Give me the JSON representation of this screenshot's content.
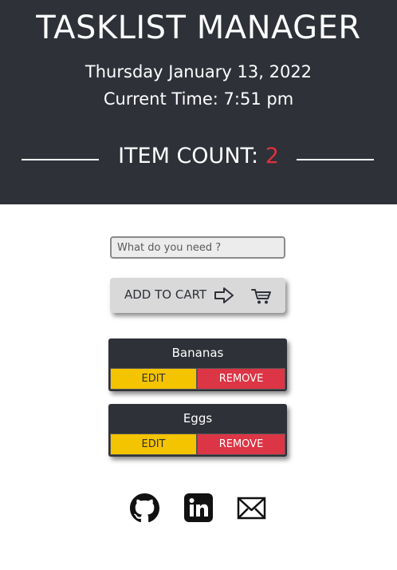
{
  "header": {
    "title": "TASKLIST MANAGER",
    "date": "Thursday January 13, 2022",
    "time": "Current Time: 7:51 pm",
    "item_count_label": "ITEM COUNT: ",
    "item_count": "2"
  },
  "form": {
    "input_placeholder": "What do you need ?",
    "input_value": "",
    "add_button_label": "ADD TO CART",
    "icons": [
      "arrow-right-icon",
      "cart-icon"
    ]
  },
  "items": [
    {
      "name": "Bananas",
      "edit_label": "EDIT",
      "remove_label": "REMOVE"
    },
    {
      "name": "Eggs",
      "edit_label": "EDIT",
      "remove_label": "REMOVE"
    }
  ],
  "footer": {
    "icons": [
      "github-icon",
      "linkedin-icon",
      "mail-icon"
    ]
  },
  "colors": {
    "header_bg": "#2e3138",
    "count_accent": "#e0313b",
    "edit_yellow": "#f5c400",
    "remove_red": "#dc3545"
  }
}
